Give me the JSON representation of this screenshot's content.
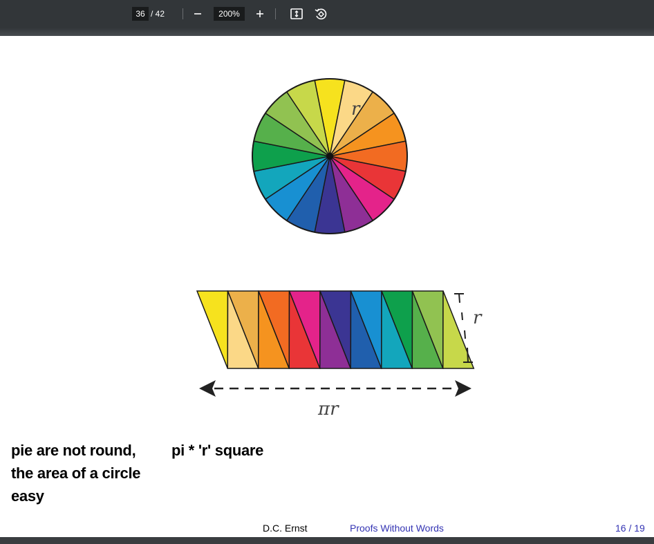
{
  "toolbar": {
    "current_page": "36",
    "total_pages": "/ 42",
    "zoom": "200%",
    "icons": [
      "minus-icon",
      "plus-icon",
      "fit-page-icon",
      "rotate-icon"
    ]
  },
  "figure": {
    "circle_label": "r",
    "height_label": "r",
    "width_label": "πr",
    "colors": [
      "#f6e21e",
      "#fbd887",
      "#ecb04a",
      "#f5931f",
      "#f26b22",
      "#e93537",
      "#e4238a",
      "#8e2f96",
      "#3b3593",
      "#205fad",
      "#1890d2",
      "#13a6bc",
      "#0ea04c",
      "#56b04b",
      "#91c251",
      "#c7d84a"
    ]
  },
  "caption": {
    "left_lines": [
      "pie are not round,",
      "the area of a circle",
      "easy"
    ],
    "right": "pi * 'r' square"
  },
  "footer": {
    "author": "D.C. Ernst",
    "title": "Proofs Without Words",
    "page": "16 / 19"
  }
}
